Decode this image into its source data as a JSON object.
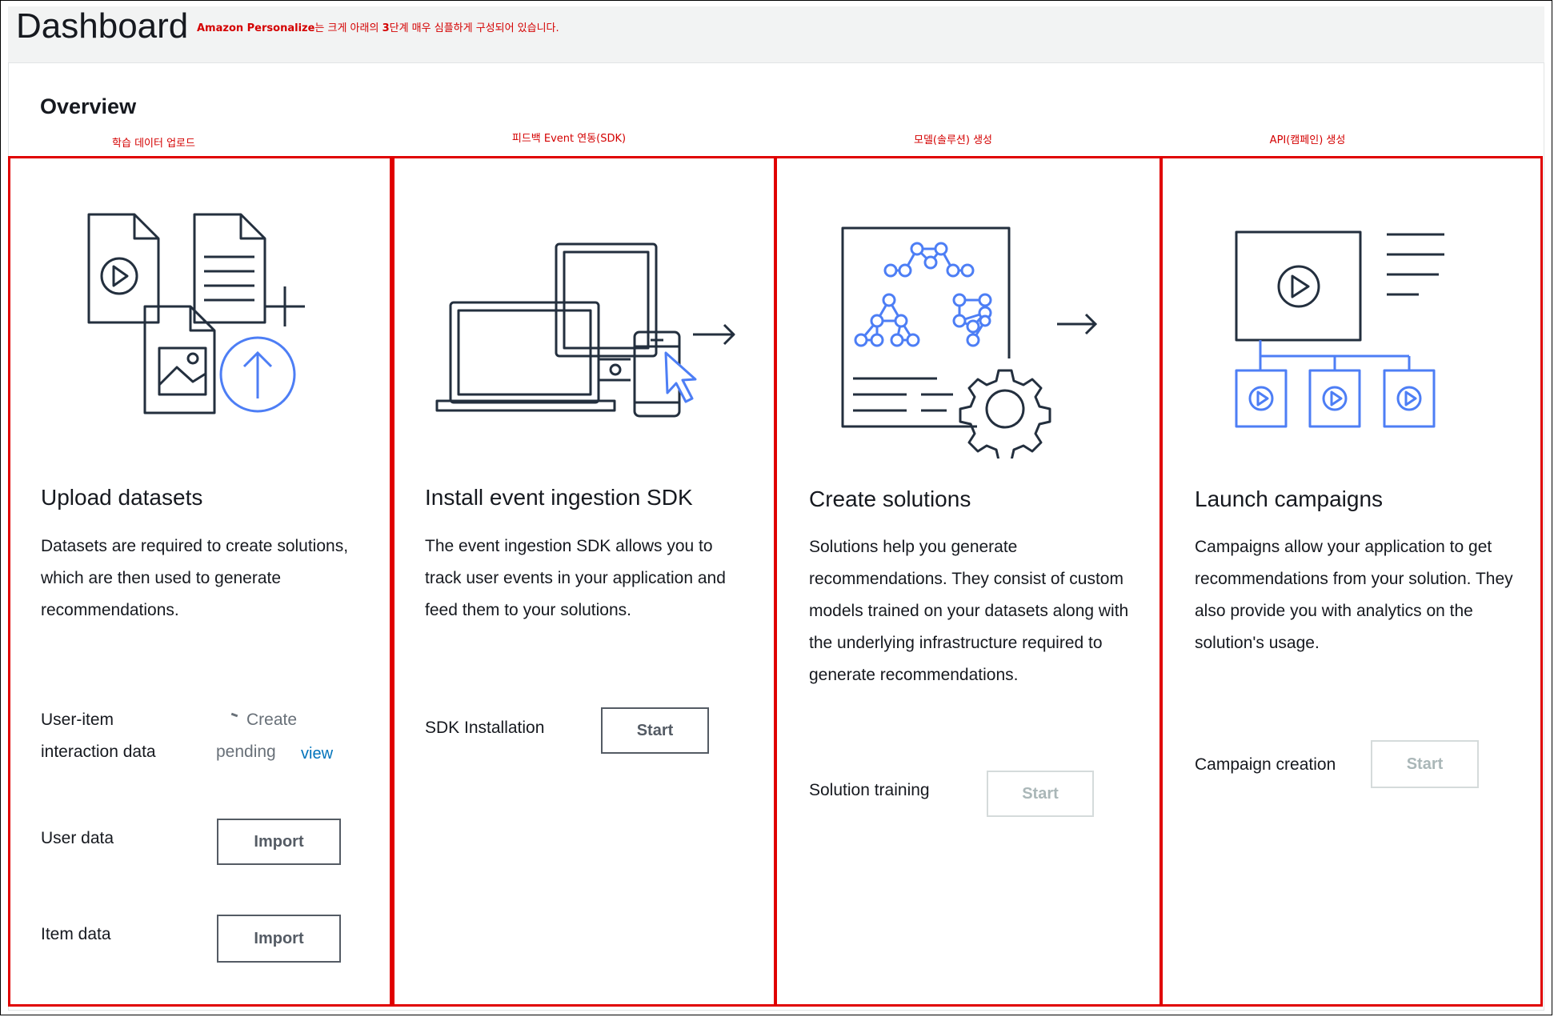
{
  "header": {
    "title": "Dashboard",
    "note_bold": "Amazon Personalize",
    "note_text": "는 크게 아래의 ",
    "note_bold2": "3",
    "note_text2": "단계 매우 심플하게 구성되어 있습니다."
  },
  "overview": {
    "title": "Overview"
  },
  "annotations": [
    "학습 데이터 업로드",
    "피드백 Event 연동(SDK)",
    "모델(솔루션) 생성",
    "API(캠페인) 생성"
  ],
  "cards": [
    {
      "title": "Upload datasets",
      "desc": "Datasets are required to create solutions, which are then used to generate recommendations.",
      "rows": [
        {
          "label_line1": "User-item",
          "label_line2": "interaction data",
          "status_line1": "Create",
          "status_line2": "pending",
          "link": "view"
        },
        {
          "label": "User data",
          "button": "Import"
        },
        {
          "label": "Item data",
          "button": "Import"
        }
      ]
    },
    {
      "title": "Install event ingestion SDK",
      "desc": "The event ingestion SDK allows you to track user events in your application and feed them to your solutions.",
      "rows": [
        {
          "label": "SDK Installation",
          "button": "Start"
        }
      ]
    },
    {
      "title": "Create solutions",
      "desc": "Solutions help you generate recommendations. They consist of custom models trained on your datasets along with the underlying infrastructure required to generate recommendations.",
      "rows": [
        {
          "label": "Solution training",
          "button": "Start"
        }
      ]
    },
    {
      "title": "Launch campaigns",
      "desc": "Campaigns allow your application to get recommendations from your solution. They also provide you with analytics on the solution's usage.",
      "rows": [
        {
          "label": "Campaign creation",
          "button": "Start"
        }
      ]
    }
  ],
  "icons": {
    "card1": "upload-datasets-icon",
    "card2": "devices-event-icon",
    "card3": "solutions-network-gear-icon",
    "card4": "campaign-video-tree-icon"
  },
  "colors": {
    "annotation_red": "#e00000",
    "accent_blue": "#4d7ef5",
    "link_blue": "#0073bb"
  }
}
